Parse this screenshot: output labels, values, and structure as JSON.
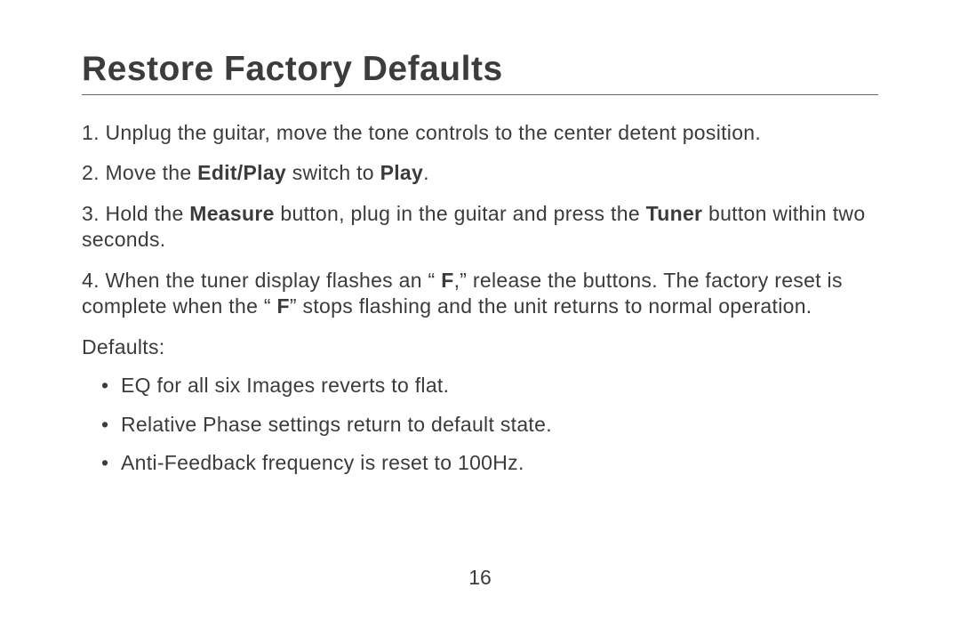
{
  "title": "Restore Factory Defaults",
  "steps": {
    "s1_pre": "1. Unplug the guitar, move the tone controls to the center detent position.",
    "s2_pre": "2. Move the ",
    "s2_b1": "Edit/Play",
    "s2_mid": " switch to ",
    "s2_b2": "Play",
    "s2_post": ".",
    "s3_pre": "3. Hold the ",
    "s3_b1": "Measure",
    "s3_mid": " button, plug in the guitar and press the ",
    "s3_b2": "Tuner",
    "s3_post": " button within two seconds.",
    "s4_pre": "4. When the tuner display flashes an “ ",
    "s4_b1": "F",
    "s4_mid": ",”  release the buttons. The factory reset is complete when the “ ",
    "s4_b2": "F",
    "s4_post": "” stops flashing and the unit returns to normal operation."
  },
  "defaults_label": "Defaults:",
  "bullets": {
    "b1": "EQ for all six Images reverts to flat.",
    "b2": "Relative Phase settings return to default state.",
    "b3": "Anti-Feedback frequency is reset to 100Hz."
  },
  "page_number": "16"
}
